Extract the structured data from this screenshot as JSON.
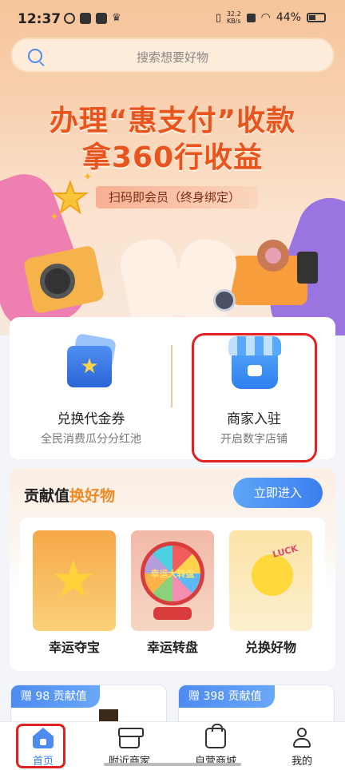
{
  "status_bar": {
    "time": "12:37",
    "net_speed_value": "32.2",
    "net_speed_unit": "KB/s",
    "battery": "44%"
  },
  "search": {
    "placeholder": "搜索想要好物"
  },
  "banner": {
    "line1": "办理“惠支付”收款",
    "line2": "拿360行收益",
    "subtitle": "扫码即会员（终身绑定）"
  },
  "features": [
    {
      "title": "兑换代金券",
      "subtitle": "全民消费瓜分分红池",
      "icon": "coupon-icon"
    },
    {
      "title": "商家入驻",
      "subtitle": "开启数字店铺",
      "icon": "store-icon"
    }
  ],
  "contribution": {
    "title_part1": "贡献值",
    "title_part2": "换好物",
    "enter_button": "立即进入",
    "prizes": [
      {
        "label": "幸运夺宝",
        "badge": ""
      },
      {
        "label": "幸运转盘",
        "badge": "幸运大转盘"
      },
      {
        "label": "兑换好物",
        "badge": "LUCK"
      }
    ]
  },
  "bottom_cards": [
    {
      "badge": "赠 98 贡献值"
    },
    {
      "badge": "赠 398 贡献值"
    }
  ],
  "tabbar": {
    "tabs": [
      {
        "label": "首页",
        "icon": "home-icon",
        "active": true
      },
      {
        "label": "附近商家",
        "icon": "shop-icon",
        "active": false
      },
      {
        "label": "自营商城",
        "icon": "bag-icon",
        "active": false
      },
      {
        "label": "我的",
        "icon": "user-icon",
        "active": false
      }
    ]
  },
  "colors": {
    "accent_blue": "#3b7ff0",
    "banner_orange": "#e8541e",
    "highlight_red": "#e02222"
  }
}
